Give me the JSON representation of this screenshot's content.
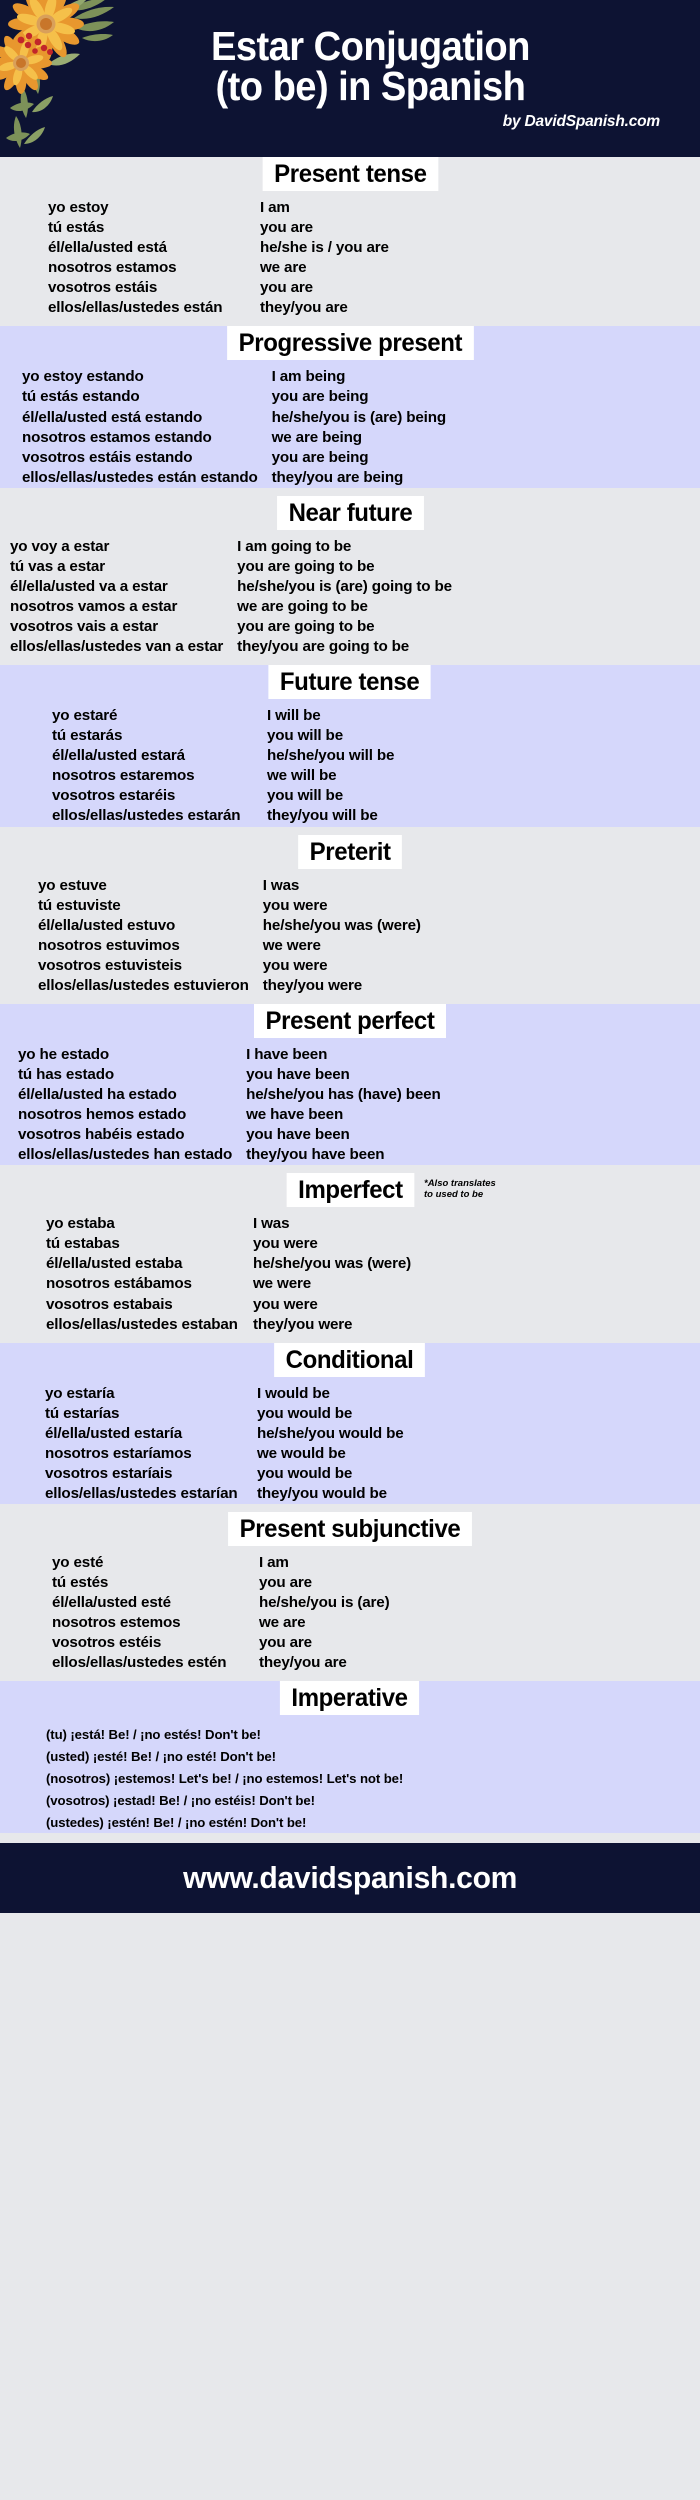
{
  "header": {
    "title_line1": "Estar Conjugation",
    "title_line2": "(to be) in Spanish",
    "byline": "by DavidSpanish.com",
    "bg_color": "#0d1333",
    "decoration": "sunflower-bouquet"
  },
  "colors": {
    "dark_navy": "#0d1333",
    "light_gray": "#e7e8eb",
    "lavender": "#d5d7fb",
    "heading_bg": "#ffffff",
    "text": "#000000",
    "flower_orange": "#f2a33c",
    "flower_yellow": "#f5c542",
    "flower_center": "#c8762a",
    "leaf_green": "#7d9159",
    "berry_red": "#c2262a"
  },
  "sections": [
    {
      "id": "present-tense",
      "title": "Present tense",
      "theme": "light",
      "rows": [
        {
          "es": "yo estoy",
          "en": "I am"
        },
        {
          "es": "tú estás",
          "en": "you are"
        },
        {
          "es": "él/ella/usted está",
          "en": "he/she is / you are"
        },
        {
          "es": "nosotros estamos",
          "en": "we are"
        },
        {
          "es": "vosotros estáis",
          "en": "you are"
        },
        {
          "es": "ellos/ellas/ustedes están",
          "en": "they/you are"
        }
      ]
    },
    {
      "id": "progressive-present",
      "title": "Progressive present",
      "theme": "lav",
      "rows": [
        {
          "es": "yo estoy estando",
          "en": "I am being"
        },
        {
          "es": "tú estás estando",
          "en": "you are being"
        },
        {
          "es": "él/ella/usted está estando",
          "en": "he/she/you is (are) being"
        },
        {
          "es": "nosotros estamos estando",
          "en": "we are being"
        },
        {
          "es": "vosotros estáis estando",
          "en": "you are being"
        },
        {
          "es": "ellos/ellas/ustedes están estando",
          "en": "they/you are being"
        }
      ]
    },
    {
      "id": "near-future",
      "title": "Near future",
      "theme": "light",
      "rows": [
        {
          "es": "yo voy a estar",
          "en": "I am going to be"
        },
        {
          "es": "tú vas a estar",
          "en": "you are going to be"
        },
        {
          "es": "él/ella/usted va a estar",
          "en": "he/she/you is (are) going to be"
        },
        {
          "es": "nosotros vamos a estar",
          "en": "we are going to be"
        },
        {
          "es": "vosotros vais a estar",
          "en": "you are going to be"
        },
        {
          "es": "ellos/ellas/ustedes van a estar",
          "en": "they/you are going to be"
        }
      ]
    },
    {
      "id": "future-tense",
      "title": "Future tense",
      "theme": "lav",
      "rows": [
        {
          "es": "yo estaré",
          "en": "I will be"
        },
        {
          "es": "tú estarás",
          "en": "you will be"
        },
        {
          "es": "él/ella/usted estará",
          "en": "he/she/you will be"
        },
        {
          "es": "nosotros estaremos",
          "en": "we will be"
        },
        {
          "es": "vosotros estaréis",
          "en": "you will be"
        },
        {
          "es": "ellos/ellas/ustedes estarán",
          "en": "they/you will be"
        }
      ]
    },
    {
      "id": "preterit",
      "title": "Preterit",
      "theme": "light",
      "rows": [
        {
          "es": "yo estuve",
          "en": "I was"
        },
        {
          "es": "tú estuviste",
          "en": "you were"
        },
        {
          "es": "él/ella/usted estuvo",
          "en": "he/she/you was (were)"
        },
        {
          "es": "nosotros estuvimos",
          "en": "we were"
        },
        {
          "es": "vosotros estuvisteis",
          "en": "you were"
        },
        {
          "es": "ellos/ellas/ustedes estuvieron",
          "en": "they/you were"
        }
      ]
    },
    {
      "id": "present-perfect",
      "title": "Present perfect",
      "theme": "lav",
      "rows": [
        {
          "es": "yo he estado",
          "en": "I have been"
        },
        {
          "es": "tú has estado",
          "en": "you have been"
        },
        {
          "es": "él/ella/usted ha estado",
          "en": "he/she/you has (have) been"
        },
        {
          "es": "nosotros hemos estado",
          "en": "we have been"
        },
        {
          "es": "vosotros habéis estado",
          "en": "you have been"
        },
        {
          "es": "ellos/ellas/ustedes han estado",
          "en": "they/you have been"
        }
      ]
    },
    {
      "id": "imperfect",
      "title": "Imperfect",
      "theme": "light",
      "note_line1": "*Also translates",
      "note_line2": "to used to be",
      "rows": [
        {
          "es": "yo estaba",
          "en": "I was"
        },
        {
          "es": "tú estabas",
          "en": "you were"
        },
        {
          "es": "él/ella/usted estaba",
          "en": "he/she/you was (were)"
        },
        {
          "es": "nosotros estábamos",
          "en": "we were"
        },
        {
          "es": "vosotros estabais",
          "en": "you were"
        },
        {
          "es": "ellos/ellas/ustedes estaban",
          "en": "they/you were"
        }
      ]
    },
    {
      "id": "conditional",
      "title": "Conditional",
      "theme": "lav",
      "rows": [
        {
          "es": "yo estaría",
          "en": "I would be"
        },
        {
          "es": "tú estarías",
          "en": "you would be"
        },
        {
          "es": "él/ella/usted estaría",
          "en": "he/she/you would be"
        },
        {
          "es": "nosotros estaríamos",
          "en": "we would be"
        },
        {
          "es": "vosotros estaríais",
          "en": "you would be"
        },
        {
          "es": "ellos/ellas/ustedes estarían",
          "en": "they/you would be"
        }
      ]
    },
    {
      "id": "present-subjunctive",
      "title": "Present subjunctive",
      "theme": "light",
      "rows": [
        {
          "es": "yo esté",
          "en": "I am"
        },
        {
          "es": "tú estés",
          "en": "you are"
        },
        {
          "es": "él/ella/usted esté",
          "en": "he/she/you is (are)"
        },
        {
          "es": "nosotros estemos",
          "en": "we are"
        },
        {
          "es": "vosotros estéis",
          "en": "you are"
        },
        {
          "es": "ellos/ellas/ustedes estén",
          "en": "they/you are"
        }
      ]
    }
  ],
  "imperative": {
    "id": "imperative",
    "title": "Imperative",
    "theme": "lav",
    "lines": [
      "(tu) ¡está! Be! / ¡no estés! Don't be!",
      "(usted) ¡esté! Be! / ¡no esté! Don't be!",
      "(nosotros)  ¡estemos! Let's be! / ¡no estemos! Let's not be!",
      "(vosotros) ¡estad! Be! / ¡no estéis! Don't be!",
      "(ustedes) ¡estén! Be! / ¡no estén! Don't be!"
    ]
  },
  "footer": {
    "url": "www.davidspanish.com",
    "bg_color": "#0d1333"
  }
}
